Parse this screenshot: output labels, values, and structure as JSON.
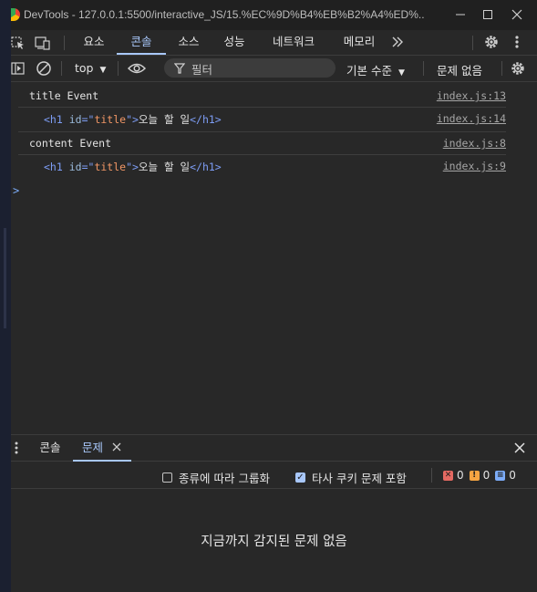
{
  "window": {
    "title": "DevTools - 127.0.0.1:5500/interactive_JS/15.%EC%9D%B4%EB%B2%A4%ED%..."
  },
  "tabs": [
    {
      "label": "요소"
    },
    {
      "label": "콘솔"
    },
    {
      "label": "소스"
    },
    {
      "label": "성능"
    },
    {
      "label": "네트워크"
    },
    {
      "label": "메모리"
    }
  ],
  "toolbar": {
    "context": "top",
    "filter_placeholder": "필터",
    "levels": "기본 수준",
    "issues": "문제 없음"
  },
  "logs": [
    {
      "message": "title Event",
      "source": "index.js:13"
    },
    {
      "tag_open": "<h1",
      "attr_name": "id",
      "attr_eq": "=\"",
      "attr_value": "title",
      "attr_close": "\">",
      "text": "오늘 할 일",
      "tag_close": "</h1>",
      "source": "index.js:14"
    },
    {
      "message": "content Event",
      "source": "index.js:8"
    },
    {
      "tag_open": "<h1",
      "attr_name": "id",
      "attr_eq": "=\"",
      "attr_value": "title",
      "attr_close": "\">",
      "text": "오늘 할 일",
      "tag_close": "</h1>",
      "source": "index.js:9"
    }
  ],
  "prompt": ">",
  "drawer": {
    "tabs": [
      {
        "label": "콘솔"
      },
      {
        "label": "문제"
      }
    ],
    "group_by_kind": "종류에 따라 그룹화",
    "third_party": "타사 쿠키 문제 포함",
    "counts": {
      "errors": "0",
      "warnings": "0",
      "info": "0"
    },
    "empty_message": "지금까지 감지된 문제 없음"
  },
  "colors": {
    "accent": "#a8c7fa",
    "background": "#282828",
    "error": "#e46962",
    "warning": "#f5a442",
    "info": "#7cacf8"
  }
}
